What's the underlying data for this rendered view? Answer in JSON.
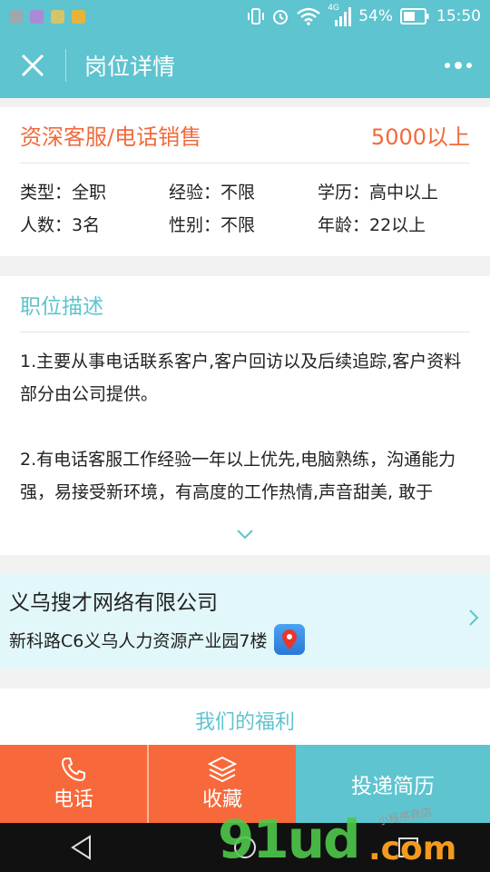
{
  "status_bar": {
    "network": "4G",
    "battery": "54%",
    "time": "15:50"
  },
  "nav": {
    "title": "岗位详情"
  },
  "job": {
    "title": "资深客服/电话销售",
    "salary": "5000以上",
    "info": [
      "类型：全职",
      "经验：不限",
      "学历：高中以上",
      "人数：3名",
      "性别：不限",
      "年龄：22以上"
    ]
  },
  "description": {
    "title": "职位描述",
    "paragraphs": [
      "1.主要从事电话联系客户,客户回访以及后续追踪,客户资料部分由公司提供。",
      "2.有电话客服工作经验一年以上优先,电脑熟练，沟通能力强，易接受新环境，有高度的工作热情,声音甜美, 敢于"
    ]
  },
  "company": {
    "name": "义乌搜才网络有限公司",
    "address": "新科路C6义乌人力资源产业园7楼"
  },
  "benefits": {
    "title": "我们的福利"
  },
  "bottom_bar": {
    "phone_label": "电话",
    "favorite_label": "收藏",
    "apply_label": "投递简历"
  },
  "watermark": {
    "main": "91ud",
    "suffix": ".com",
    "caption": "小程序商店"
  },
  "colors": {
    "accent": "#5ec4cf",
    "orange": "#f26a3c",
    "button_orange": "#f7693a"
  }
}
